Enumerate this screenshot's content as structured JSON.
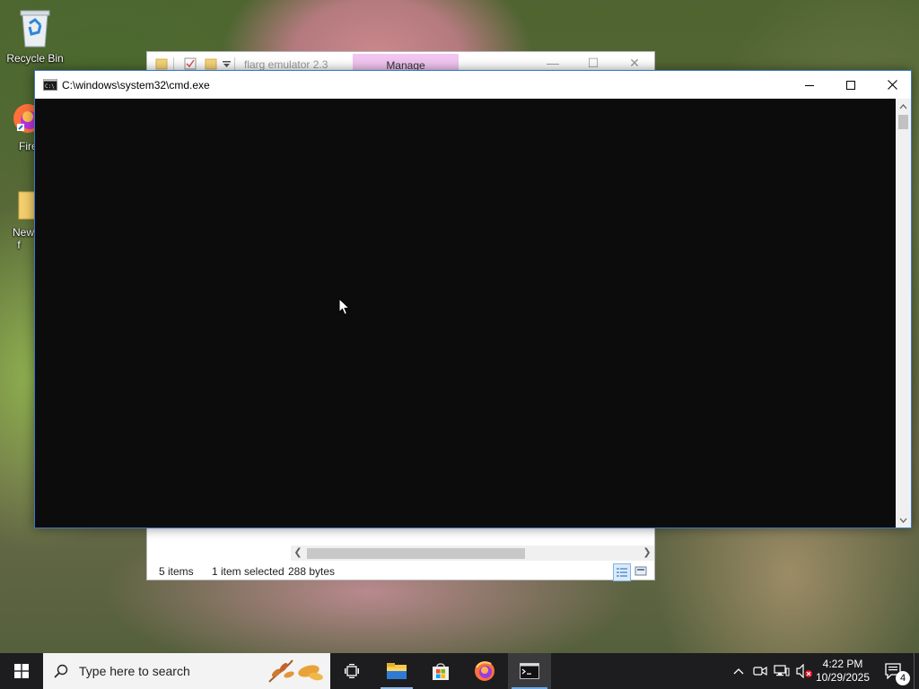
{
  "desktop": {
    "icons": [
      {
        "label": "Recycle Bin"
      },
      {
        "label": "Fire"
      },
      {
        "label": "New f"
      }
    ]
  },
  "explorer": {
    "title": "flarg emulator 2.3",
    "manage_tab": "Manage",
    "status": {
      "items_count": "5 items",
      "selection": "1 item selected",
      "size": "288 bytes"
    }
  },
  "cmd": {
    "title": "C:\\windows\\system32\\cmd.exe",
    "icon": "cmd-app-icon"
  },
  "taskbar": {
    "search_placeholder": "Type here to search",
    "apps": [
      {
        "name": "task-view"
      },
      {
        "name": "file-explorer"
      },
      {
        "name": "microsoft-store"
      },
      {
        "name": "firefox"
      },
      {
        "name": "command-prompt"
      }
    ],
    "clock": {
      "time": "4:22 PM",
      "date": "10/29/2025"
    },
    "notifications_count": "4"
  },
  "colors": {
    "cmd_bg": "#0c0c0c",
    "taskbar_bg": "#1d1d1f",
    "manage_tab_bg": "#f1c6f0",
    "active_accent": "#6aa8e8"
  }
}
